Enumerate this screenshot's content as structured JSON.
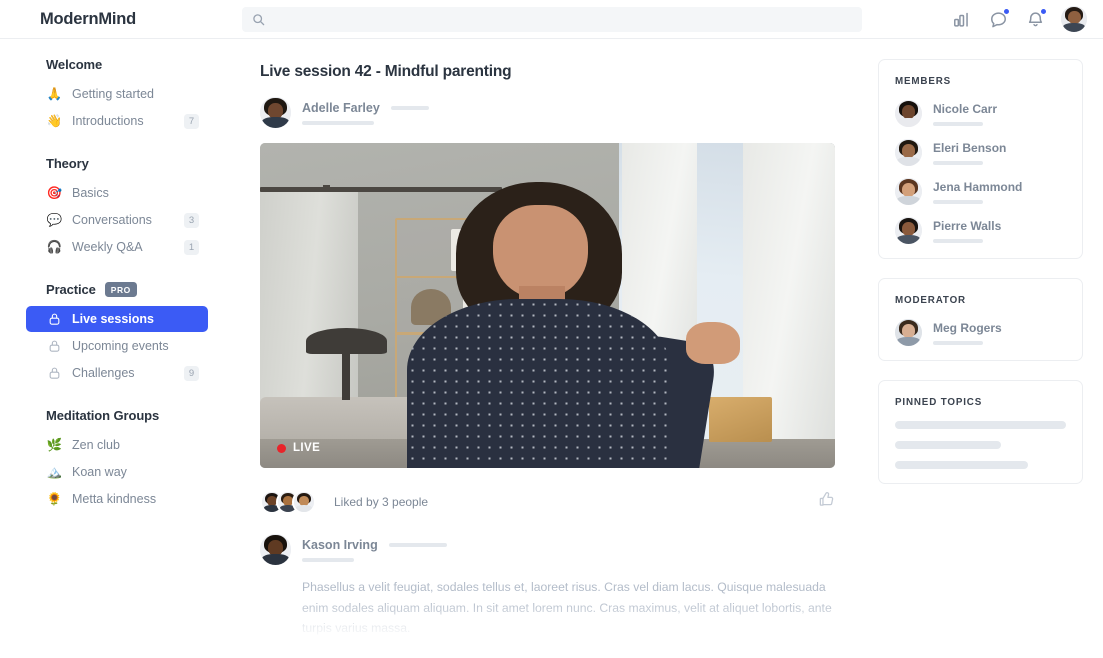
{
  "brand": "ModernMind",
  "search": {
    "value": "",
    "placeholder": "",
    "icon": "search-icon"
  },
  "topbar_icons": [
    {
      "name": "analytics-icon",
      "badge": false
    },
    {
      "name": "messages-icon",
      "badge": true
    },
    {
      "name": "notifications-icon",
      "badge": true
    }
  ],
  "colors": {
    "accent": "#3b5bf5",
    "live": "#e8242a",
    "pro_badge": "#6c7a90",
    "muted_text": "#7c8796",
    "badge_bg": "#eef1f4",
    "skeleton": "#e4e8ed"
  },
  "sidebar": {
    "groups": [
      {
        "title": "Welcome",
        "badge": null,
        "items": [
          {
            "label": "Getting started",
            "icon": "🙏",
            "count": null,
            "active": false,
            "locked": false
          },
          {
            "label": "Introductions",
            "icon": "👋",
            "count": "7",
            "active": false,
            "locked": false
          }
        ]
      },
      {
        "title": "Theory",
        "badge": null,
        "items": [
          {
            "label": "Basics",
            "icon": "🎯",
            "count": null,
            "active": false,
            "locked": false
          },
          {
            "label": "Conversations",
            "icon": "💬",
            "count": "3",
            "active": false,
            "locked": false
          },
          {
            "label": "Weekly Q&A",
            "icon": "🎧",
            "count": "1",
            "active": false,
            "locked": false
          }
        ]
      },
      {
        "title": "Practice",
        "badge": "PRO",
        "items": [
          {
            "label": "Live sessions",
            "icon": "lock",
            "count": null,
            "active": true,
            "locked": true
          },
          {
            "label": "Upcoming events",
            "icon": "lock",
            "count": null,
            "active": false,
            "locked": true
          },
          {
            "label": "Challenges",
            "icon": "lock",
            "count": "9",
            "active": false,
            "locked": true
          }
        ]
      },
      {
        "title": "Meditation Groups",
        "badge": null,
        "items": [
          {
            "label": "Zen club",
            "icon": "🌿",
            "count": null,
            "active": false,
            "locked": false
          },
          {
            "label": "Koan way",
            "icon": "🏔️",
            "count": null,
            "active": false,
            "locked": false
          },
          {
            "label": "Metta kindness",
            "icon": "🌻",
            "count": null,
            "active": false,
            "locked": false
          }
        ]
      }
    ]
  },
  "post": {
    "title": "Live session 42 - Mindful parenting",
    "author": "Adelle Farley",
    "video": {
      "live_label": "LIVE",
      "is_live": true
    },
    "likes_text": "Liked by 3 people",
    "like_button_icon": "thumbs-up-icon"
  },
  "comment": {
    "author": "Kason Irving",
    "text": "Phasellus a velit feugiat, sodales tellus et, laoreet risus. Cras vel diam lacus. Quisque malesuada enim sodales aliquam aliquam. In sit amet lorem nunc. Cras maximus, velit at aliquet lobortis, ante turpis varius massa."
  },
  "rail": {
    "members": {
      "title": "MEMBERS",
      "people": [
        {
          "name": "Nicole Carr"
        },
        {
          "name": "Eleri Benson"
        },
        {
          "name": "Jena Hammond"
        },
        {
          "name": "Pierre Walls"
        }
      ]
    },
    "moderator": {
      "title": "MODERATOR",
      "people": [
        {
          "name": "Meg Rogers"
        }
      ]
    },
    "pinned": {
      "title": "PINNED TOPICS",
      "placeholder_widths": [
        "100%",
        "62%",
        "78%"
      ]
    }
  }
}
